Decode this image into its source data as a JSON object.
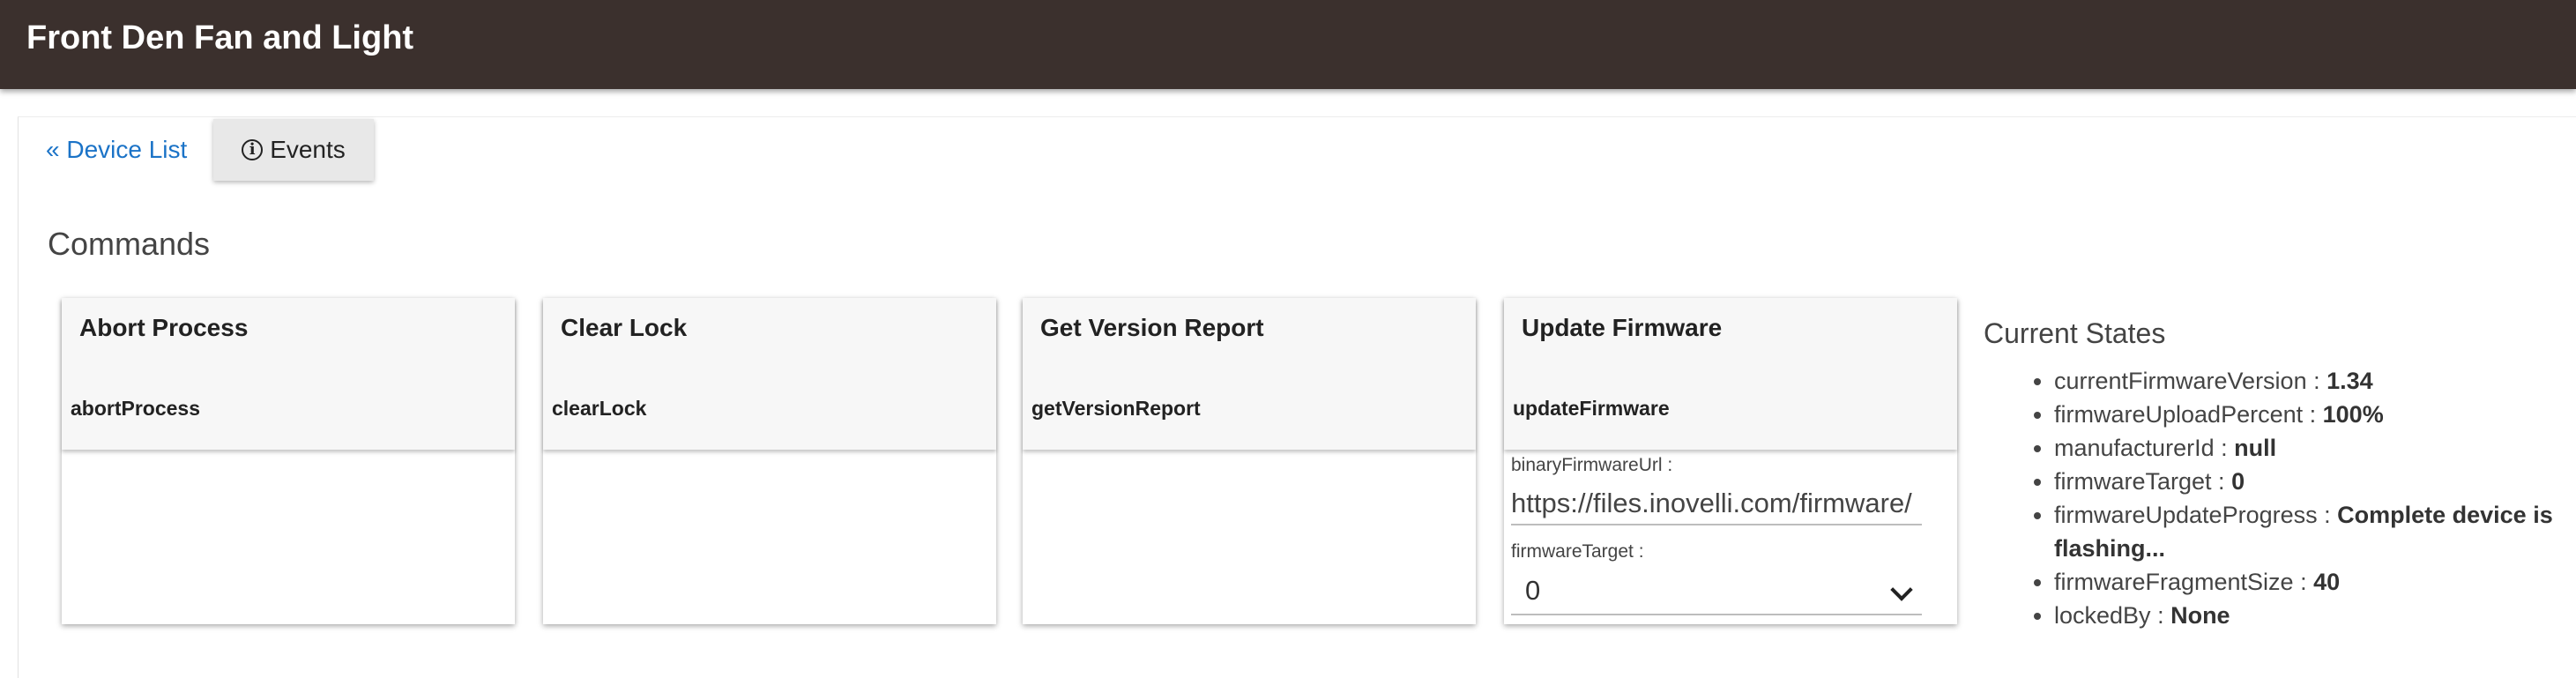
{
  "header": {
    "title": "Front Den Fan and Light"
  },
  "nav": {
    "back_link": "« Device List",
    "events_label": "Events",
    "events_icon": "info-icon"
  },
  "commands": {
    "title": "Commands",
    "cards": [
      {
        "title": "Abort Process",
        "command": "abortProcess"
      },
      {
        "title": "Clear Lock",
        "command": "clearLock"
      },
      {
        "title": "Get Version Report",
        "command": "getVersionReport"
      },
      {
        "title": "Update Firmware",
        "command": "updateFirmware",
        "params": {
          "url_label": "binaryFirmwareUrl :",
          "url_value": "https://files.inovelli.com/firmware/",
          "target_label": "firmwareTarget :",
          "target_value": "0"
        }
      }
    ]
  },
  "current_states": {
    "title": "Current States",
    "items": [
      {
        "key": "currentFirmwareVersion",
        "value": "1.34"
      },
      {
        "key": "firmwareUploadPercent",
        "value": "100%"
      },
      {
        "key": "manufacturerId",
        "value": "null"
      },
      {
        "key": "firmwareTarget",
        "value": "0"
      },
      {
        "key": "firmwareUpdateProgress",
        "value": "Complete device is flashing..."
      },
      {
        "key": "firmwareFragmentSize",
        "value": "40"
      },
      {
        "key": "lockedBy",
        "value": "None"
      }
    ]
  },
  "colors": {
    "header_bg": "#3b302d",
    "link": "#1b73c7",
    "button_bg": "#e8e8e8"
  }
}
